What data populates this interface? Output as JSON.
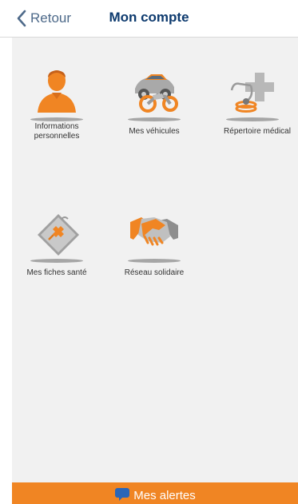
{
  "nav": {
    "back_label": "Retour",
    "title": "Mon compte"
  },
  "tiles": [
    {
      "label": "Informations\npersonnelles",
      "icon": "person-icon"
    },
    {
      "label": "Mes véhicules",
      "icon": "vehicles-icon"
    },
    {
      "label": "Répertoire médical",
      "icon": "medical-directory-icon"
    },
    {
      "label": "Mes fiches santé",
      "icon": "health-file-icon"
    },
    {
      "label": "Réseau solidaire",
      "icon": "handshake-icon"
    }
  ],
  "footer": {
    "alerts_label": "Mes alertes",
    "icon": "chat-bubble-icon"
  },
  "colors": {
    "accent_orange": "#f08523",
    "title_blue": "#0d3a6e",
    "background": "#f1f1f1"
  }
}
